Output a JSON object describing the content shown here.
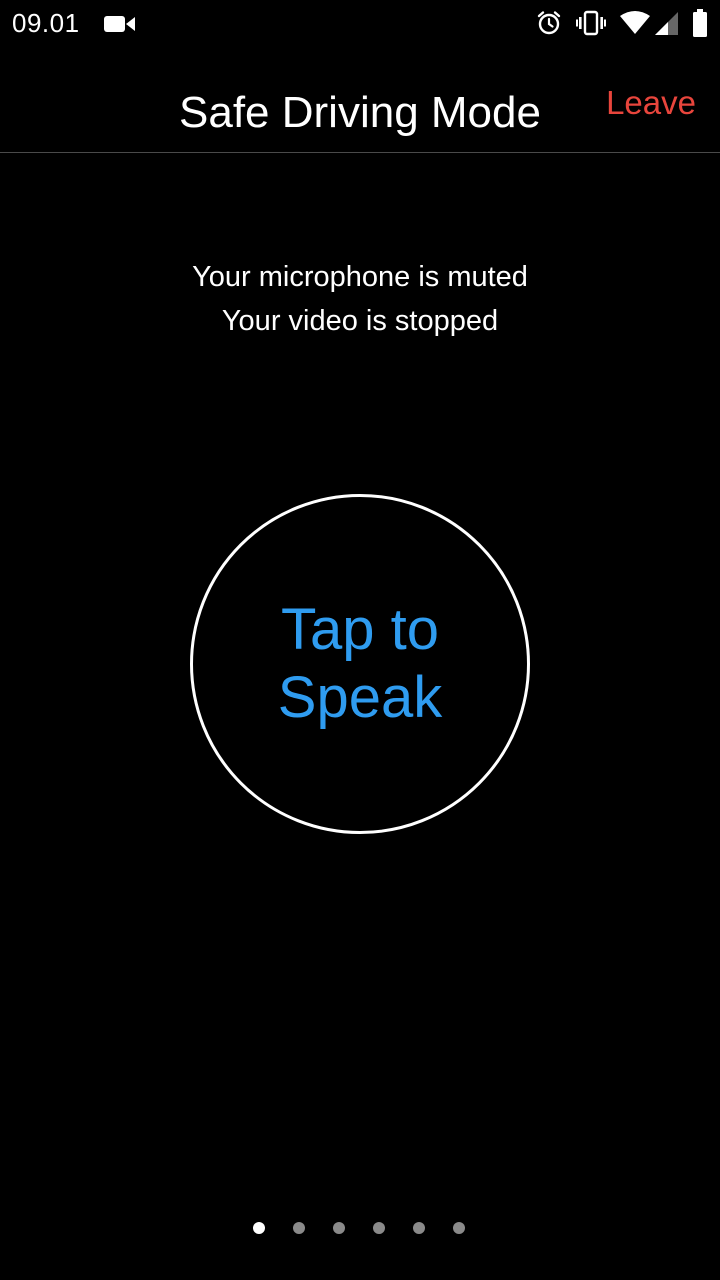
{
  "status_bar": {
    "time": "09.01",
    "icons": [
      "video-camera-icon",
      "alarm-icon",
      "vibrate-icon",
      "wifi-icon",
      "cell-signal-icon",
      "battery-icon"
    ]
  },
  "header": {
    "title": "Safe Driving Mode",
    "leave_label": "Leave",
    "leave_color": "#e8453c"
  },
  "status_messages": {
    "microphone": "Your microphone is muted",
    "video": "Your video is stopped"
  },
  "speak_button": {
    "line1": "Tap to",
    "line2": "Speak",
    "color": "#2f9cf0"
  },
  "pagination": {
    "total_pages": 6,
    "current_page": 1
  }
}
